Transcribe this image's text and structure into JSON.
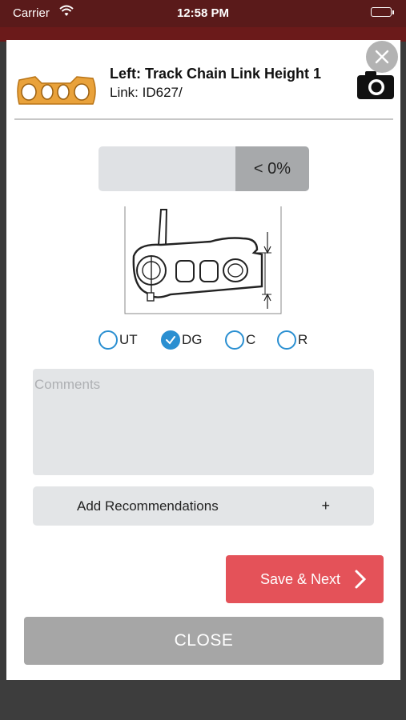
{
  "status_bar": {
    "carrier": "Carrier",
    "time": "12:58 PM",
    "wifi_icon": "wifi-icon",
    "battery_icon": "battery-icon"
  },
  "header": {
    "title": "Left: Track Chain Link Height 1",
    "subtitle": "Link: ID627/",
    "thumbnail": "track-chain-link-thumbnail",
    "camera_icon": "camera-icon",
    "close_icon": "close-icon"
  },
  "wear_gauge": {
    "percent_label": "< 0%",
    "fill_fraction": 0
  },
  "measurement_tools": {
    "options": [
      {
        "label": "UT",
        "checked": false
      },
      {
        "label": "DG",
        "checked": true
      },
      {
        "label": "C",
        "checked": false
      },
      {
        "label": "R",
        "checked": false
      }
    ]
  },
  "comments": {
    "placeholder": "Comments",
    "value": ""
  },
  "recommendations": {
    "label": "Add Recommendations",
    "plus": "+"
  },
  "actions": {
    "save_next_label": "Save & Next",
    "close_label": "CLOSE"
  },
  "colors": {
    "status_bar_bg": "#5a1a1a",
    "accent_blue": "#2a8fd1",
    "save_red": "#e45259",
    "close_gray": "#a6a6a6",
    "thumbnail_gold": "#e9a23b"
  }
}
